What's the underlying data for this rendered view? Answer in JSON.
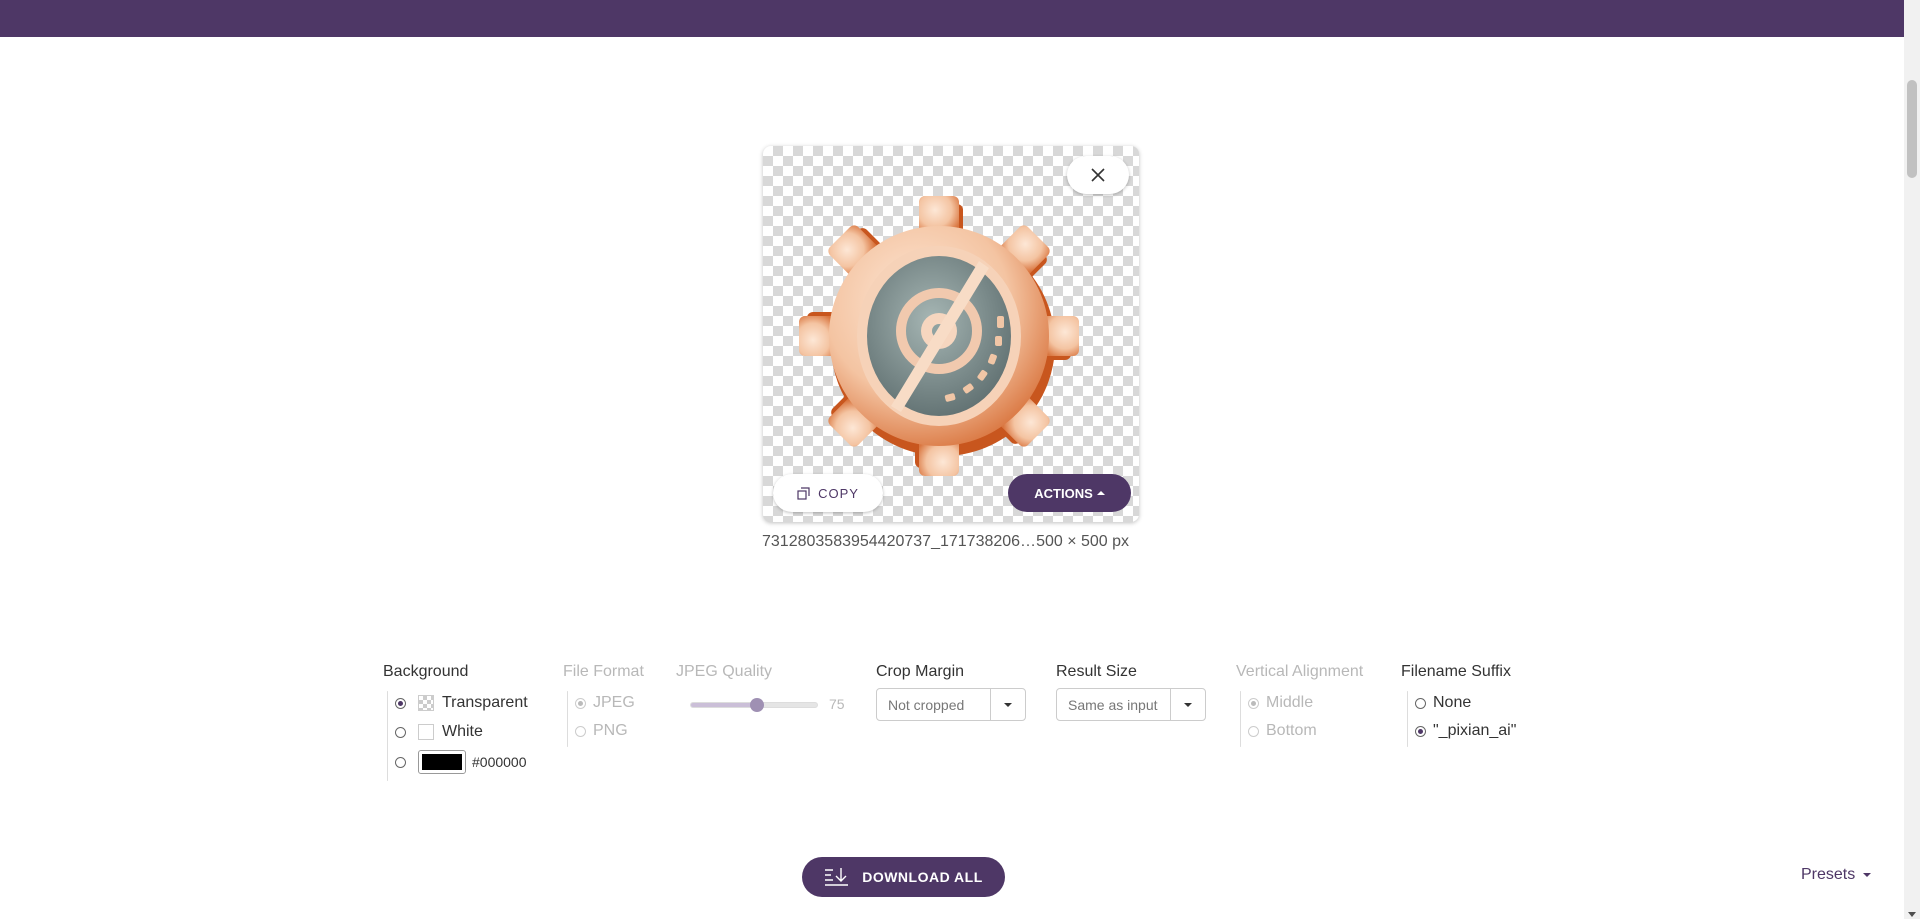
{
  "card": {
    "copy_label": "COPY",
    "actions_label": "ACTIONS",
    "filename": "7312803583954420737_171738206…",
    "dimensions": "500 × 500 px"
  },
  "options": {
    "background": {
      "title": "Background",
      "items": [
        {
          "label": "Transparent",
          "selected": true
        },
        {
          "label": "White",
          "selected": false
        },
        {
          "label": "#000000",
          "selected": false,
          "color": "#000000"
        }
      ]
    },
    "file_format": {
      "title": "File Format",
      "disabled": true,
      "items": [
        {
          "label": "JPEG",
          "selected": true
        },
        {
          "label": "PNG",
          "selected": false
        }
      ]
    },
    "jpeg_quality": {
      "title": "JPEG Quality",
      "disabled": true,
      "value": "75",
      "value_fraction": 0.52
    },
    "crop_margin": {
      "title": "Crop Margin",
      "value": "Not cropped"
    },
    "result_size": {
      "title": "Result Size",
      "value": "Same as input"
    },
    "vertical_alignment": {
      "title": "Vertical Alignment",
      "disabled": true,
      "items": [
        {
          "label": "Middle",
          "selected": true
        },
        {
          "label": "Bottom",
          "selected": false
        }
      ]
    },
    "filename_suffix": {
      "title": "Filename Suffix",
      "items": [
        {
          "label": "None",
          "selected": false
        },
        {
          "label": "\"_pixian_ai\"",
          "selected": true
        }
      ]
    }
  },
  "footer": {
    "download_label": "DOWNLOAD ALL",
    "presets_label": "Presets"
  },
  "colors": {
    "brand": "#4e3766",
    "topbar": "#4e3766"
  }
}
